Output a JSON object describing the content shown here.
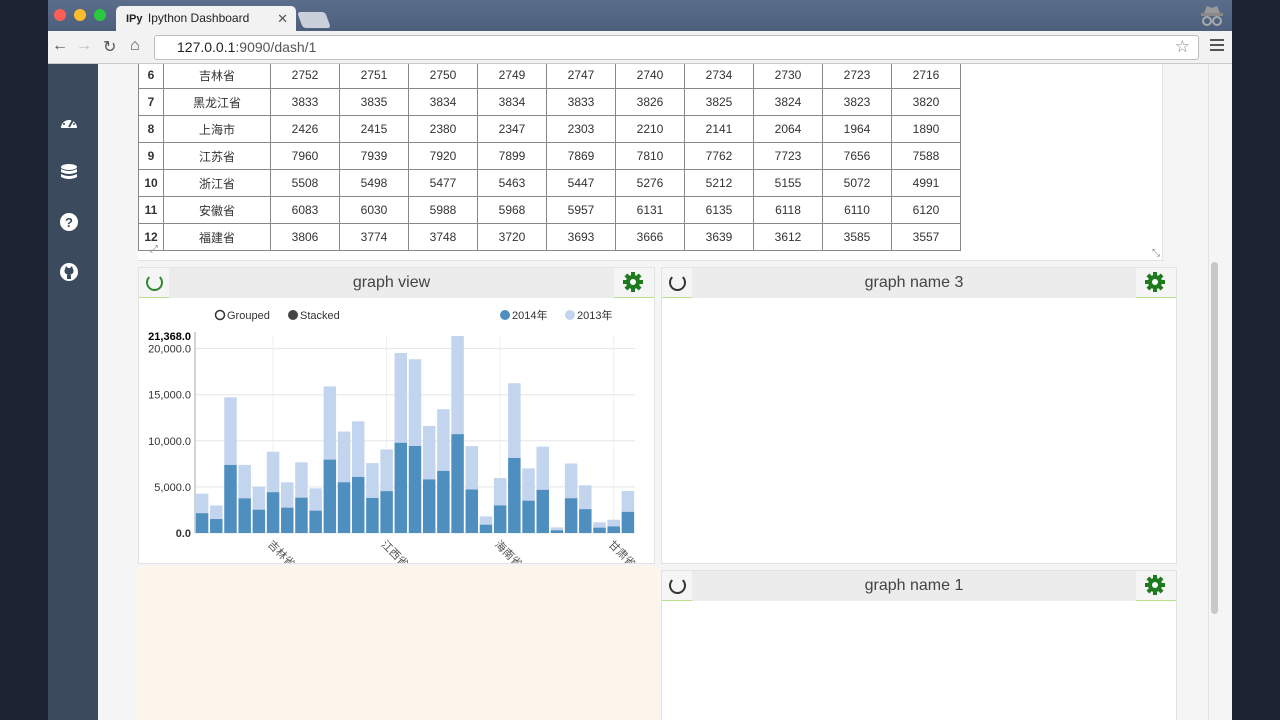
{
  "browser": {
    "tab_title": "Ipython Dashboard",
    "tab_badge": "IPy",
    "url_host": "127.0.0.1",
    "url_rest": ":9090/dash/1"
  },
  "table": {
    "rows": [
      {
        "idx": "6",
        "province": "吉林省",
        "values": [
          "2752",
          "2751",
          "2750",
          "2749",
          "2747",
          "2740",
          "2734",
          "2730",
          "2723",
          "2716"
        ]
      },
      {
        "idx": "7",
        "province": "黑龙江省",
        "values": [
          "3833",
          "3835",
          "3834",
          "3834",
          "3833",
          "3826",
          "3825",
          "3824",
          "3823",
          "3820"
        ]
      },
      {
        "idx": "8",
        "province": "上海市",
        "values": [
          "2426",
          "2415",
          "2380",
          "2347",
          "2303",
          "2210",
          "2141",
          "2064",
          "1964",
          "1890"
        ]
      },
      {
        "idx": "9",
        "province": "江苏省",
        "values": [
          "7960",
          "7939",
          "7920",
          "7899",
          "7869",
          "7810",
          "7762",
          "7723",
          "7656",
          "7588"
        ]
      },
      {
        "idx": "10",
        "province": "浙江省",
        "values": [
          "5508",
          "5498",
          "5477",
          "5463",
          "5447",
          "5276",
          "5212",
          "5155",
          "5072",
          "4991"
        ]
      },
      {
        "idx": "11",
        "province": "安徽省",
        "values": [
          "6083",
          "6030",
          "5988",
          "5968",
          "5957",
          "6131",
          "6135",
          "6118",
          "6110",
          "6120"
        ]
      },
      {
        "idx": "12",
        "province": "福建省",
        "values": [
          "3806",
          "3774",
          "3748",
          "3720",
          "3693",
          "3666",
          "3639",
          "3612",
          "3585",
          "3557"
        ]
      }
    ]
  },
  "panels": {
    "graph_view": {
      "title": "graph view"
    },
    "graph3": {
      "title": "graph name 3"
    },
    "graph1": {
      "title": "graph name 1"
    }
  },
  "chart_controls": {
    "grouped": "Grouped",
    "stacked": "Stacked"
  },
  "colors": {
    "series_2014": "#4f8fc0",
    "series_2013": "#c3d5ee",
    "accent_green": "#2a8a2a"
  },
  "chart_data": {
    "type": "bar",
    "stacked": true,
    "y_max_label": "21,368.0",
    "ylim": [
      0,
      21368
    ],
    "yticks": [
      {
        "v": 0,
        "label": "0.0"
      },
      {
        "v": 5000,
        "label": "5,000.0"
      },
      {
        "v": 10000,
        "label": "10,000.0"
      },
      {
        "v": 15000,
        "label": "15,000.0"
      },
      {
        "v": 20000,
        "label": "20,000.0"
      }
    ],
    "x_tick_labels": [
      "吉林省",
      "江西省",
      "海南省",
      "甘肃省"
    ],
    "x_tick_indices": [
      5,
      13,
      21,
      29
    ],
    "series": [
      {
        "name": "2014年",
        "values": [
          2152,
          1517,
          7384,
          3761,
          2531,
          4426,
          2752,
          3833,
          2426,
          7960,
          5508,
          6083,
          3806,
          4542,
          9789,
          9436,
          5816,
          6737,
          10724,
          4719,
          903,
          2991,
          8140,
          3508,
          4686,
          301,
          3774,
          2591,
          578,
          720,
          2298
        ]
      },
      {
        "name": "2013年",
        "values": [
          2115,
          1472,
          7333,
          3630,
          2498,
          4390,
          2751,
          3835,
          2415,
          7939,
          5498,
          6030,
          3774,
          4522,
          9733,
          9413,
          5799,
          6691,
          10644,
          4710,
          895,
          2970,
          8107,
          3502,
          4687,
          312,
          3764,
          2582,
          578,
          720,
          2264
        ]
      }
    ]
  }
}
